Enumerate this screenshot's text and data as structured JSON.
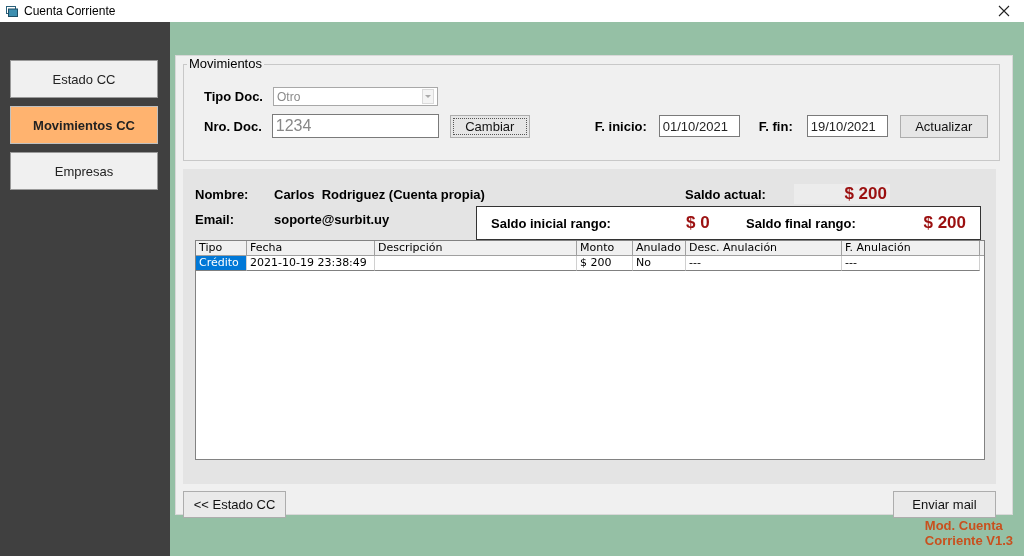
{
  "window": {
    "title": "Cuenta Corriente"
  },
  "sidebar": {
    "items": [
      {
        "label": "Estado CC",
        "selected": false
      },
      {
        "label": "Movimientos CC",
        "selected": true
      },
      {
        "label": "Empresas",
        "selected": false
      }
    ]
  },
  "group": {
    "title": "Movimientos"
  },
  "filters": {
    "tipo_doc_label": "Tipo Doc.",
    "tipo_doc": {
      "value": "Otro",
      "disabled": true
    },
    "nro_doc_label": "Nro. Doc.",
    "nro_doc": "1234",
    "change_button": "Cambiar",
    "start_label": "F. inicio:",
    "start_date": "01/10/2021",
    "end_label": "F. fin:",
    "end_date": "19/10/2021",
    "update_button": "Actualizar"
  },
  "account": {
    "name_label": "Nombre:",
    "name": "Carlos  Rodriguez (Cuenta propia)",
    "email_label": "Email:",
    "email": "soporte@surbit.uy",
    "balance_label": "Saldo actual:",
    "balance": "$ 200",
    "range_start_label": "Saldo inicial rango:",
    "range_start": "$ 0",
    "range_end_label": "Saldo final rango:",
    "range_end": "$ 200"
  },
  "table": {
    "columns": [
      "Tipo",
      "Fecha",
      "Descripción",
      "Monto",
      "Anulado",
      "Desc. Anulación",
      "F. Anulación"
    ],
    "rows": [
      {
        "selected": true,
        "cells": [
          "Crédito",
          "2021-10-19 23:38:49",
          null,
          "$ 200",
          "No",
          "---",
          "---"
        ]
      }
    ]
  },
  "footer": {
    "back_button": "<< Estado CC",
    "mail_button": "Enviar mail",
    "version_lines": [
      "Mod. Cuenta",
      "Corriente V1.3"
    ]
  }
}
